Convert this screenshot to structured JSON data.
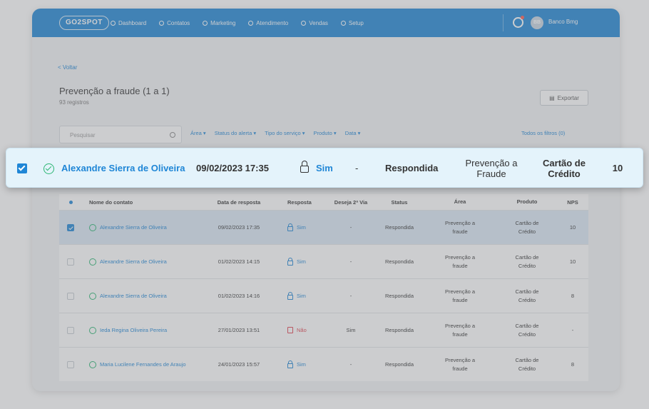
{
  "topbar": {
    "logo": "GO2SPOT",
    "nav": [
      "Dashboard",
      "Contatos",
      "Marketing",
      "Atendimento",
      "Vendas",
      "Setup"
    ],
    "user": "Banco Bmg",
    "avatar": "BB"
  },
  "page": {
    "back": "< Voltar",
    "title": "Prevenção a fraude (1 a 1)",
    "subtitle": "93 registros",
    "export_label": "Exportar",
    "search_placeholder": "Pesquisar",
    "filters": [
      "Área",
      "Status do alerta",
      "Tipo do serviço",
      "Produto",
      "Data"
    ],
    "all_filters": "Todos os filtros (0)"
  },
  "table": {
    "headers": [
      "Nome do contato",
      "Data de resposta",
      "Resposta",
      "Deseja 2ª Via",
      "Status",
      "Área",
      "Produto",
      "NPS"
    ],
    "rows": [
      {
        "name": "Alexandre Sierra de Oliveira",
        "date": "09/02/2023 17:35",
        "resp": "Sim",
        "via": "-",
        "status": "Respondida",
        "area1": "Prevenção a",
        "area2": "fraude",
        "prod1": "Cartão de",
        "prod2": "Crédito",
        "nps": "10"
      },
      {
        "name": "Alexandre Sierra de Oliveira",
        "date": "01/02/2023 14:15",
        "resp": "Sim",
        "via": "-",
        "status": "Respondida",
        "area1": "Prevenção a",
        "area2": "fraude",
        "prod1": "Cartão de",
        "prod2": "Crédito",
        "nps": "10"
      },
      {
        "name": "Alexandre Sierra de Oliveira",
        "date": "01/02/2023 14:16",
        "resp": "Sim",
        "via": "-",
        "status": "Respondida",
        "area1": "Prevenção a",
        "area2": "fraude",
        "prod1": "Cartão de",
        "prod2": "Crédito",
        "nps": "8"
      },
      {
        "name": "Ieda Regina Oliveira Pereira",
        "date": "27/01/2023 13:51",
        "resp": "Não",
        "via": "Sim",
        "status": "Respondida",
        "area1": "Prevenção a",
        "area2": "fraude",
        "prod1": "Cartão de",
        "prod2": "Crédito",
        "nps": "-"
      },
      {
        "name": "Maria Lucilene Fernandes de Araujo",
        "date": "24/01/2023 15:57",
        "resp": "Sim",
        "via": "-",
        "status": "Respondida",
        "area1": "Prevenção a",
        "area2": "fraude",
        "prod1": "Cartão de",
        "prod2": "Crédito",
        "nps": "8"
      }
    ]
  },
  "focus": {
    "name": "Alexandre Sierra de Oliveira",
    "date": "09/02/2023 17:35",
    "resp": "Sim",
    "via": "-",
    "status": "Respondida",
    "area1": "Prevenção a",
    "area2": "Fraude",
    "prod1": "Cartão de",
    "prod2": "Crédito",
    "nps": "10"
  },
  "colors": {
    "primary": "#1f86d6",
    "success": "#2bb673",
    "danger": "#e0424f",
    "highlight": "#e4f3fb"
  }
}
